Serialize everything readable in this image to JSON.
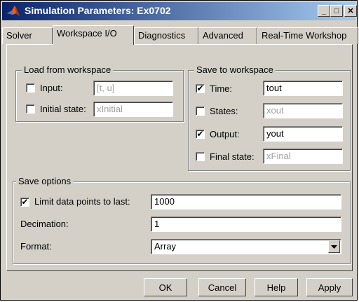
{
  "window": {
    "title": "Simulation Parameters: Ex0702"
  },
  "titlebar": {
    "minimize": "_",
    "maximize": "□",
    "close": "✕"
  },
  "tabs": [
    {
      "label": "Solver"
    },
    {
      "label": "Workspace I/O"
    },
    {
      "label": "Diagnostics"
    },
    {
      "label": "Advanced"
    },
    {
      "label": "Real-Time Workshop"
    }
  ],
  "load": {
    "title": "Load from workspace",
    "input": {
      "label": "Input:",
      "checked": false,
      "value": "[t, u]"
    },
    "initial_state": {
      "label": "Initial state:",
      "checked": false,
      "value": "xInitial"
    }
  },
  "save": {
    "title": "Save to workspace",
    "time": {
      "label": "Time:",
      "checked": true,
      "value": "tout"
    },
    "states": {
      "label": "States:",
      "checked": false,
      "value": "xout"
    },
    "output": {
      "label": "Output:",
      "checked": true,
      "value": "yout"
    },
    "final_state": {
      "label": "Final state:",
      "checked": false,
      "value": "xFinal"
    }
  },
  "options": {
    "title": "Save options",
    "limit": {
      "label": "Limit data points to last:",
      "checked": true,
      "value": "1000"
    },
    "decimation": {
      "label": "Decimation:",
      "value": "1"
    },
    "format": {
      "label": "Format:",
      "value": "Array"
    }
  },
  "buttons": {
    "ok": "OK",
    "cancel": "Cancel",
    "help": "Help",
    "apply": "Apply"
  },
  "check_mark": "✔"
}
